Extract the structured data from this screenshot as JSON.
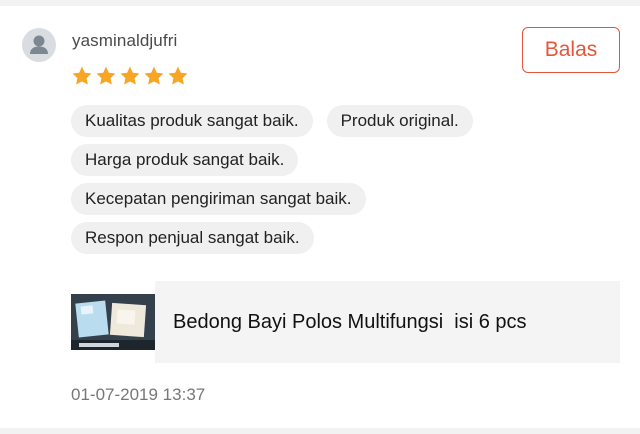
{
  "review": {
    "username": "yasminaldjufri",
    "rating": 5,
    "rating_max": 5,
    "reply_label": "Balas",
    "tags": [
      "Kualitas produk sangat baik.",
      "Produk original.",
      "Harga produk sangat baik.",
      "Kecepatan pengiriman sangat baik.",
      "Respon penjual sangat baik."
    ],
    "product": {
      "name": "Bedong Bayi Polos Multifungsi  isi 6 pcs"
    },
    "timestamp": "01-07-2019 13:37"
  },
  "colors": {
    "accent": "#e2563c",
    "star": "#f6a623",
    "tag_bg": "#f0f0f0",
    "product_bg": "#f4f4f4",
    "muted_text": "#777777"
  },
  "icons": {
    "avatar": "user-avatar-icon",
    "star": "star-icon"
  }
}
